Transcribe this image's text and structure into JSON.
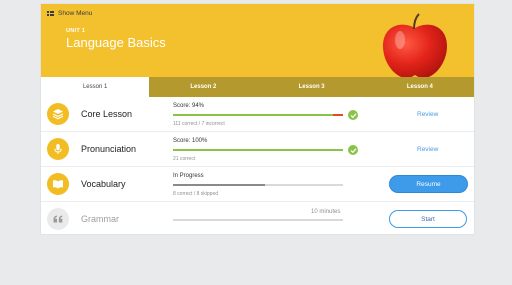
{
  "header": {
    "menu_label": "Show Menu",
    "unit_label": "UNIT 1",
    "unit_title": "Language Basics"
  },
  "tabs": [
    {
      "label": "Lesson 1",
      "active": true
    },
    {
      "label": "Lesson 2",
      "active": false
    },
    {
      "label": "Lesson 3",
      "active": false
    },
    {
      "label": "Lesson 4",
      "active": false
    }
  ],
  "activities": [
    {
      "name": "Core Lesson",
      "icon": "layers-icon",
      "status": "Score: 94%",
      "progress": 0.94,
      "detail": "111 correct / 7 incorrect",
      "action": "Review"
    },
    {
      "name": "Pronunciation",
      "icon": "microphone-icon",
      "status": "Score: 100%",
      "progress": 1.0,
      "detail": "21 correct",
      "action": "Review"
    },
    {
      "name": "Vocabulary",
      "icon": "book-icon",
      "status": "In Progress",
      "progress": 0.54,
      "detail": "8 correct / 8 skipped",
      "action": "Resume"
    },
    {
      "name": "Grammar",
      "icon": "quote-icon",
      "duration": "10 minutes",
      "progress": 0,
      "action": "Start"
    }
  ],
  "colors": {
    "header_yellow": "#f3c12d",
    "tab_gold": "#b49a2e",
    "progress_green": "#8bc34a",
    "progress_red": "#e8472f",
    "progress_gray": "#8a8a8a",
    "accent_blue": "#3d9be9"
  }
}
